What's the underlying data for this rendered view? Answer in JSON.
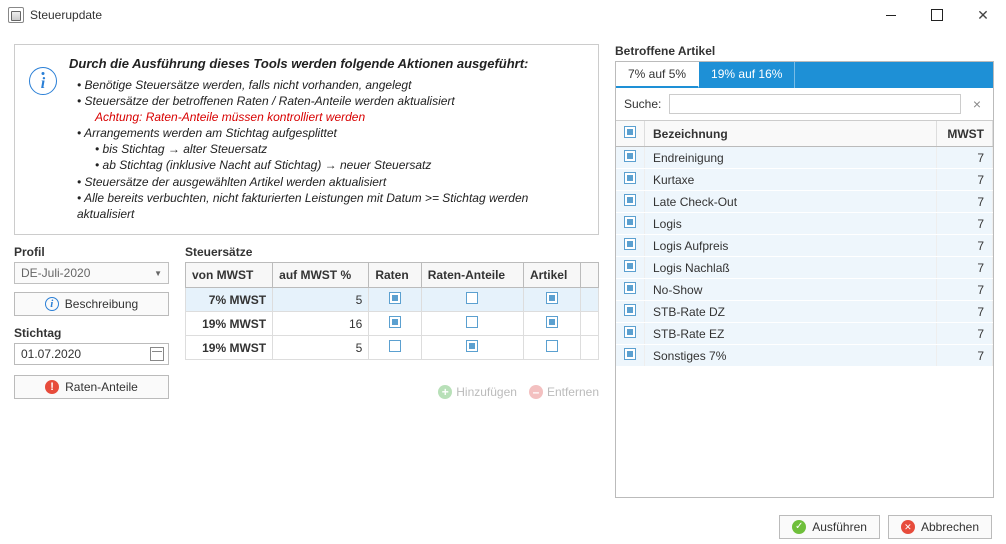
{
  "window": {
    "title": "Steuerupdate"
  },
  "info": {
    "heading": "Durch die Ausführung dieses Tools werden folgende Aktionen ausgeführt:",
    "l1": "• Benötige Steuersätze werden, falls nicht vorhanden, angelegt",
    "l2": "• Steuersätze der betroffenen Raten / Raten-Anteile werden aktualisiert",
    "warn": "Achtung: Raten-Anteile müssen kontrolliert werden",
    "l3": "• Arrangements werden am Stichtag aufgesplittet",
    "l3a": "• bis Stichtag → alter Steuersatz",
    "l3b": "• ab Stichtag (inklusive Nacht auf Stichtag) → neuer Steuersatz",
    "l4": "• Steuersätze der ausgewählten Artikel werden aktualisiert",
    "l5": "• Alle bereits verbuchten, nicht fakturierten Leistungen mit Datum >= Stichtag werden aktualisiert"
  },
  "profil": {
    "label": "Profil",
    "value": "DE-Juli-2020",
    "desc_btn": "Beschreibung"
  },
  "stichtag": {
    "label": "Stichtag",
    "value": "01.07.2020",
    "raten_btn": "Raten-Anteile"
  },
  "steuersaetze": {
    "label": "Steuersätze",
    "headers": {
      "von": "von MWST",
      "auf": "auf MWST %",
      "raten": "Raten",
      "ra": "Raten-Anteile",
      "art": "Artikel"
    },
    "rows": [
      {
        "von": "7% MWST",
        "auf": "5",
        "raten": true,
        "ra": false,
        "art": true
      },
      {
        "von": "19% MWST",
        "auf": "16",
        "raten": true,
        "ra": false,
        "art": true
      },
      {
        "von": "19% MWST",
        "auf": "5",
        "raten": false,
        "ra": true,
        "art": false
      }
    ],
    "add": "Hinzufügen",
    "remove": "Entfernen"
  },
  "artikel": {
    "label": "Betroffene Artikel",
    "tabs": {
      "t1": "7% auf 5%",
      "t2": "19% auf 16%"
    },
    "search_label": "Suche:",
    "headers": {
      "bez": "Bezeichnung",
      "mwst": "MWST"
    },
    "rows": [
      {
        "bez": "Endreinigung",
        "mwst": "7"
      },
      {
        "bez": "Kurtaxe",
        "mwst": "7"
      },
      {
        "bez": "Late Check-Out",
        "mwst": "7"
      },
      {
        "bez": "Logis",
        "mwst": "7"
      },
      {
        "bez": "Logis Aufpreis",
        "mwst": "7"
      },
      {
        "bez": "Logis Nachlaß",
        "mwst": "7"
      },
      {
        "bez": "No-Show",
        "mwst": "7"
      },
      {
        "bez": "STB-Rate DZ",
        "mwst": "7"
      },
      {
        "bez": "STB-Rate EZ",
        "mwst": "7"
      },
      {
        "bez": "Sonstiges 7%",
        "mwst": "7"
      }
    ]
  },
  "footer": {
    "ok": "Ausführen",
    "cancel": "Abbrechen"
  }
}
